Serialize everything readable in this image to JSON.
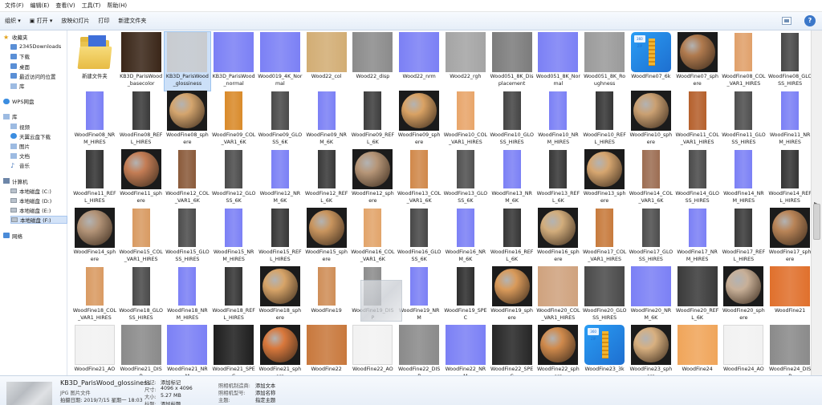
{
  "menu": [
    "文件(F)",
    "编辑(E)",
    "查看(V)",
    "工具(T)",
    "帮助(H)"
  ],
  "toolbar": [
    "组织 ▾",
    "▣  打开 ▾",
    "放映幻灯片",
    "打印",
    "新建文件夹"
  ],
  "help_label": "?",
  "sidebar": {
    "favorites_title": "收藏夹",
    "favorites": [
      {
        "label": "2345Downloads",
        "icon": "folder-blue"
      },
      {
        "label": "下载",
        "icon": "folder-blue"
      },
      {
        "label": "桌面",
        "icon": "folder-blue"
      },
      {
        "label": "最近访问的位置",
        "icon": "folder-blue"
      },
      {
        "label": "库",
        "icon": "lib"
      }
    ],
    "wps": "WPS网盘",
    "library_title": "库",
    "libraries": [
      {
        "label": "视频",
        "icon": "lib"
      },
      {
        "label": "天翼云盘下载",
        "icon": "cloud"
      },
      {
        "label": "图片",
        "icon": "lib"
      },
      {
        "label": "文档",
        "icon": "lib"
      },
      {
        "label": "音乐",
        "icon": "music"
      }
    ],
    "computer_title": "计算机",
    "drives": [
      {
        "label": "本地磁盘 (C:)"
      },
      {
        "label": "本地磁盘 (D:)"
      },
      {
        "label": "本地磁盘 (E:)"
      },
      {
        "label": "本地磁盘 (F:)"
      }
    ],
    "network": "网络"
  },
  "files": [
    {
      "name": "新建文件夹",
      "kind": "folder"
    },
    {
      "name": "KB3D_ParisWood_basecolor",
      "kind": "square",
      "color": "#3a2618"
    },
    {
      "name": "KB3D_ParisWood_glossiness",
      "kind": "square",
      "color": "#c9ccd0",
      "selected": true
    },
    {
      "name": "KB3D_ParisWood_normal",
      "kind": "square",
      "color": "#7b80f5"
    },
    {
      "name": "Wood019_4K_Normal",
      "kind": "square",
      "color": "#7b80f5"
    },
    {
      "name": "Wood22_col",
      "kind": "square",
      "color": "#d2ad74"
    },
    {
      "name": "Wood22_disp",
      "kind": "square",
      "color": "#8b8b8b"
    },
    {
      "name": "Wood22_nrm",
      "kind": "square",
      "color": "#7b80f5"
    },
    {
      "name": "Wood22_rgh",
      "kind": "square",
      "color": "#a4a4a4"
    },
    {
      "name": "Wood051_8K_Displacement",
      "kind": "square",
      "color": "#7c7c7c"
    },
    {
      "name": "Wood051_8K_Normal",
      "kind": "square",
      "color": "#7b80f5"
    },
    {
      "name": "Wood051_8K_Roughness",
      "kind": "square",
      "color": "#9a9a9a"
    },
    {
      "name": "WoodFine07_6k",
      "kind": "zip"
    },
    {
      "name": "WoodFine07_sphere",
      "kind": "ball",
      "color": "#b07a4e"
    },
    {
      "name": "WoodFine08_COL_VAR1_HIRES",
      "kind": "tall",
      "color": "#e0a06a"
    },
    {
      "name": "WoodFine08_GLOSS_HIRES",
      "kind": "tall",
      "color": "#474747"
    },
    {
      "name": "WoodFine08_NRM_HIRES",
      "kind": "tall",
      "color": "#7b80f5"
    },
    {
      "name": "WoodFine08_REFL_HIRES",
      "kind": "tall",
      "color": "#3a3a3a"
    },
    {
      "name": "WoodFine08_sphere",
      "kind": "ball",
      "color": "#d4a56e"
    },
    {
      "name": "WoodFine09_COL_VAR1_6K",
      "kind": "tall",
      "color": "#d98a2a"
    },
    {
      "name": "WoodFine09_GLOSS_6K",
      "kind": "tall",
      "color": "#4a4a4a"
    },
    {
      "name": "WoodFine09_NRM_6K",
      "kind": "tall",
      "color": "#7b80f5"
    },
    {
      "name": "WoodFine09_REFL_6K",
      "kind": "tall",
      "color": "#3d3d3d"
    },
    {
      "name": "WoodFine09_sphere",
      "kind": "ball",
      "color": "#d9a264"
    },
    {
      "name": "WoodFine10_COL_VAR1_HIRES",
      "kind": "tall",
      "color": "#e8a56a"
    },
    {
      "name": "WoodFine10_GLOSS_HIRES",
      "kind": "tall",
      "color": "#444444"
    },
    {
      "name": "WoodFine10_NRM_HIRES",
      "kind": "tall",
      "color": "#7b80f5"
    },
    {
      "name": "WoodFine10_REFL_HIRES",
      "kind": "tall",
      "color": "#353535"
    },
    {
      "name": "WoodFine10_sphere",
      "kind": "ball",
      "color": "#caa072"
    },
    {
      "name": "WoodFine11_COL_VAR1_HIRES",
      "kind": "tall",
      "color": "#b5602c"
    },
    {
      "name": "WoodFine11_GLOSS_HIRES",
      "kind": "tall",
      "color": "#4e4e4e"
    },
    {
      "name": "WoodFine11_NRM_HIRES",
      "kind": "tall",
      "color": "#7b80f5"
    },
    {
      "name": "WoodFine11_REFL_HIRES",
      "kind": "tall",
      "color": "#333333"
    },
    {
      "name": "WoodFine11_sphere",
      "kind": "ball",
      "color": "#c47d55"
    },
    {
      "name": "WoodFine12_COL_VAR1_6K",
      "kind": "tall",
      "color": "#8a5a3a"
    },
    {
      "name": "WoodFine12_GLOSS_6K",
      "kind": "tall",
      "color": "#4b4b4b"
    },
    {
      "name": "WoodFine12_NRM_6K",
      "kind": "tall",
      "color": "#7b80f5"
    },
    {
      "name": "WoodFine12_REFL_6K",
      "kind": "tall",
      "color": "#383838"
    },
    {
      "name": "WoodFine12_sphere",
      "kind": "ball",
      "color": "#b69678"
    },
    {
      "name": "WoodFine13_COL_VAR1_6K",
      "kind": "tall",
      "color": "#d0884a"
    },
    {
      "name": "WoodFine13_GLOSS_6K",
      "kind": "tall",
      "color": "#505050"
    },
    {
      "name": "WoodFine13_NRM_6K",
      "kind": "tall",
      "color": "#7b80f5"
    },
    {
      "name": "WoodFine13_REFL_6K",
      "kind": "tall",
      "color": "#363636"
    },
    {
      "name": "WoodFine13_sphere",
      "kind": "ball",
      "color": "#d6a670"
    },
    {
      "name": "WoodFine14_COL_VAR1_6K",
      "kind": "tall",
      "color": "#9c6d52"
    },
    {
      "name": "WoodFine14_GLOSS_HIRES",
      "kind": "tall",
      "color": "#4a4a4a"
    },
    {
      "name": "WoodFine14_NRM_HIRES",
      "kind": "tall",
      "color": "#7b80f5"
    },
    {
      "name": "WoodFine14_REFL_HIRES",
      "kind": "tall",
      "color": "#343434"
    },
    {
      "name": "WoodFine14_sphere",
      "kind": "ball",
      "color": "#b39478"
    },
    {
      "name": "WoodFine15_COL_VAR1_HIRES",
      "kind": "tall",
      "color": "#d89a62"
    },
    {
      "name": "WoodFine15_GLOSS_HIRES",
      "kind": "tall",
      "color": "#4c4c4c"
    },
    {
      "name": "WoodFine15_NRM_HIRES",
      "kind": "tall",
      "color": "#7b80f5"
    },
    {
      "name": "WoodFine15_REFL_HIRES",
      "kind": "tall",
      "color": "#373737"
    },
    {
      "name": "WoodFine15_sphere",
      "kind": "ball",
      "color": "#c9955e"
    },
    {
      "name": "WoodFine16_COL_VAR1_6K",
      "kind": "tall",
      "color": "#e2a46a"
    },
    {
      "name": "WoodFine16_GLOSS_6K",
      "kind": "tall",
      "color": "#474747"
    },
    {
      "name": "WoodFine16_NRM_6K",
      "kind": "tall",
      "color": "#7b80f5"
    },
    {
      "name": "WoodFine16_REFL_6K",
      "kind": "tall",
      "color": "#353535"
    },
    {
      "name": "WoodFine16_sphere",
      "kind": "ball",
      "color": "#d2ad7c"
    },
    {
      "name": "WoodFine17_COL_VAR1_HIRES",
      "kind": "tall",
      "color": "#c77a3c"
    },
    {
      "name": "WoodFine17_GLOSS_HIRES",
      "kind": "tall",
      "color": "#4d4d4d"
    },
    {
      "name": "WoodFine17_NRM_HIRES",
      "kind": "tall",
      "color": "#7b80f5"
    },
    {
      "name": "WoodFine17_REFL_HIRES",
      "kind": "tall",
      "color": "#393939"
    },
    {
      "name": "WoodFine17_sphere",
      "kind": "ball",
      "color": "#b98457"
    },
    {
      "name": "WoodFine18_COL_VAR1_HIRES",
      "kind": "tall",
      "color": "#d99a62"
    },
    {
      "name": "WoodFine18_GLOSS_HIRES",
      "kind": "tall",
      "color": "#4a4a4a"
    },
    {
      "name": "WoodFine18_NRM_HIRES",
      "kind": "tall",
      "color": "#7b80f5"
    },
    {
      "name": "WoodFine18_REFL_HIRES",
      "kind": "tall",
      "color": "#343434"
    },
    {
      "name": "WoodFine18_sphere",
      "kind": "ball",
      "color": "#d7a468"
    },
    {
      "name": "WoodFine19",
      "kind": "tall",
      "color": "#cf8e58"
    },
    {
      "name": "WoodFine19_DISP",
      "kind": "tall",
      "color": "#8c8c8c"
    },
    {
      "name": "WoodFine19_NRM",
      "kind": "tall",
      "color": "#7b80f5"
    },
    {
      "name": "WoodFine19_SPEC",
      "kind": "tall",
      "color": "#2d2d2d"
    },
    {
      "name": "WoodFine19_sphere",
      "kind": "ball",
      "color": "#d99a5a"
    },
    {
      "name": "WoodFine20_COL_VAR1_HIRES",
      "kind": "square",
      "color": "#cfa27e"
    },
    {
      "name": "WoodFine20_GLOSS_HIRES",
      "kind": "square",
      "color": "#4a4a4a"
    },
    {
      "name": "WoodFine20_NRM_6K",
      "kind": "square",
      "color": "#7b80f5"
    },
    {
      "name": "WoodFine20_REFL_6K",
      "kind": "square",
      "color": "#3a3a3a"
    },
    {
      "name": "WoodFine20_sphere",
      "kind": "ball",
      "color": "#c8b098"
    },
    {
      "name": "WoodFine21",
      "kind": "square",
      "color": "#e0702c"
    },
    {
      "name": "WoodFine21_AO",
      "kind": "square",
      "color": "#f2f2f2"
    },
    {
      "name": "WoodFine21_DISP",
      "kind": "square",
      "color": "#8a8a8a"
    },
    {
      "name": "WoodFine21_NRM",
      "kind": "square",
      "color": "#7b80f5"
    },
    {
      "name": "WoodFine21_SPEC",
      "kind": "square",
      "color": "#1e1e1e"
    },
    {
      "name": "WoodFine21_sphere",
      "kind": "ball",
      "color": "#d9783c"
    },
    {
      "name": "WoodFine22",
      "kind": "square",
      "color": "#c8783c"
    },
    {
      "name": "WoodFine22_AO",
      "kind": "square",
      "color": "#f2f2f2"
    },
    {
      "name": "WoodFine22_DISP",
      "kind": "square",
      "color": "#8a8a8a"
    },
    {
      "name": "WoodFine22_NRM",
      "kind": "square",
      "color": "#7b80f5"
    },
    {
      "name": "WoodFine22_SPEC",
      "kind": "square",
      "color": "#262626"
    },
    {
      "name": "WoodFine22_sphere",
      "kind": "ball",
      "color": "#d08a4c"
    },
    {
      "name": "WoodFine23_3k",
      "kind": "zip"
    },
    {
      "name": "WoodFine23_sphere",
      "kind": "ball",
      "color": "#d8b080"
    },
    {
      "name": "WoodFine24",
      "kind": "square",
      "color": "#f0a55a"
    },
    {
      "name": "WoodFine24_AO",
      "kind": "square",
      "color": "#f2f2f2"
    },
    {
      "name": "WoodFine24_DISP",
      "kind": "square",
      "color": "#8a8a8a"
    }
  ],
  "zip_badge": "360\nZIP",
  "details": {
    "name": "KB3D_ParisWood_glossiness",
    "type": "JPG 图片文件",
    "date_label": "拍摄日期:",
    "date_value": "2019/7/15 星期一 18:03",
    "rows": [
      {
        "label": "标记:",
        "value": "添加标记"
      },
      {
        "label": "尺寸:",
        "value": "4096 x 4096"
      },
      {
        "label": "大小:",
        "value": "5.27 MB"
      },
      {
        "label": "标题:",
        "value": "添加标题"
      },
      {
        "label": "照相机制造商:",
        "value": "添加文本"
      },
      {
        "label": "照相机型号:",
        "value": "添加名称"
      },
      {
        "label": "主题:",
        "value": "指定主题"
      }
    ]
  }
}
